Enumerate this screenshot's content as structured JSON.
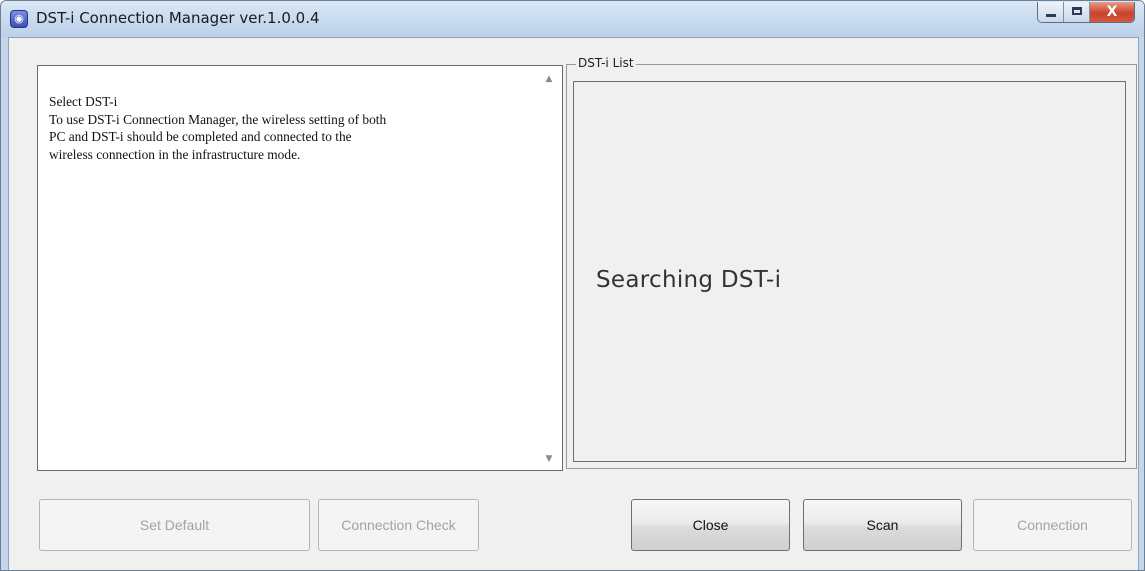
{
  "window": {
    "title": "DST-i Connection Manager ver.1.0.0.4",
    "app_icon": "dst-i-app-icon",
    "controls": {
      "minimize": "minimize-icon",
      "maximize": "maximize-icon",
      "close": "X"
    }
  },
  "help": {
    "lines": [
      "Select DST-i",
      "To use DST-i Connection Manager, the wireless setting of both",
      "PC and DST-i should be completed and connected to the",
      "wireless connection in the infrastructure mode."
    ],
    "scroll_up": "▲",
    "scroll_down": "▼"
  },
  "dst_list": {
    "group_label": "DST-i List",
    "status": "Searching DST-i"
  },
  "buttons": {
    "set_default": "Set Default",
    "connection_check": "Connection Check",
    "close": "Close",
    "scan": "Scan",
    "connection": "Connection"
  }
}
